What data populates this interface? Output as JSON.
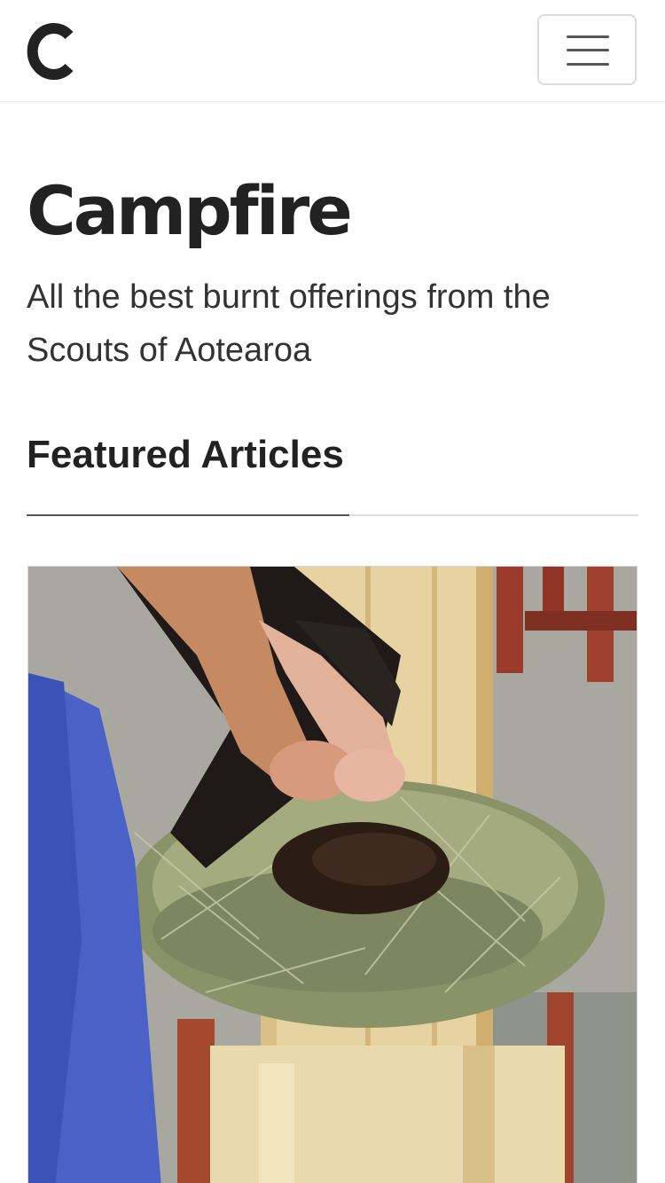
{
  "header": {
    "logo_letter": "C",
    "menu_toggle_label": "Toggle navigation"
  },
  "hero": {
    "title": "Campfire",
    "subtitle": "All the best burnt offerings from the Scouts of Aotearoa"
  },
  "featured": {
    "heading": "Featured Articles",
    "articles": [
      {
        "image_description": "hands placing a metal pot into a hay box nest on a wooden stand"
      }
    ]
  },
  "colors": {
    "text": "#222222",
    "background": "#ffffff",
    "rule": "#dddddd",
    "rule_accent": "#555555"
  }
}
